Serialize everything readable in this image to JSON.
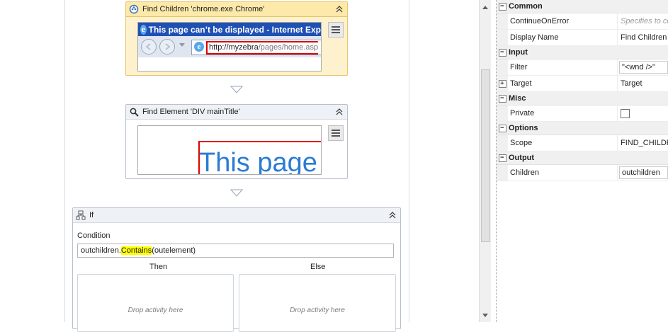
{
  "designer": {
    "find_children": {
      "title": "Find Children 'chrome.exe Chrome'",
      "preview": {
        "window_title": "This page can’t be displayed - Internet Exp",
        "url_host": "http://myzebra",
        "url_path": "/pages/home.asp"
      }
    },
    "find_element": {
      "title": "Find Element 'DIV  mainTitle'",
      "preview_text": "This page"
    },
    "if_activity": {
      "title": "If",
      "condition_label": "Condition",
      "condition_parts": {
        "prefix": "outchildren.",
        "highlight": "Contains",
        "suffix": "(outelement)"
      },
      "then_label": "Then",
      "else_label": "Else",
      "then_drop": "Drop activity here",
      "else_drop": "Drop activity here"
    }
  },
  "properties": {
    "categories": [
      {
        "name": "Common",
        "rows": [
          {
            "name": "ContinueOnError",
            "value": "",
            "placeholder": "Specifies to co"
          },
          {
            "name": "Display Name",
            "value": "Find Children '"
          }
        ]
      },
      {
        "name": "Input",
        "rows": [
          {
            "name": "Filter",
            "value": "\"<wnd />\""
          },
          {
            "name": "Target",
            "value": "Target",
            "expand": "+"
          }
        ]
      },
      {
        "name": "Misc",
        "rows": [
          {
            "name": "Private",
            "value": "",
            "checkbox": false
          }
        ]
      },
      {
        "name": "Options",
        "rows": [
          {
            "name": "Scope",
            "value": "FIND_CHILDRE"
          }
        ]
      },
      {
        "name": "Output",
        "rows": [
          {
            "name": "Children",
            "value": "outchildren"
          }
        ]
      }
    ],
    "collapse_symbol": "−"
  },
  "colors": {
    "selected_header": "#fde9a9",
    "highlight": "#ffff00",
    "ie_blue": "#1f50b4",
    "url_red": "#e00000",
    "preview_red": "#e00000",
    "preview_text_blue": "#2b7cd3"
  }
}
